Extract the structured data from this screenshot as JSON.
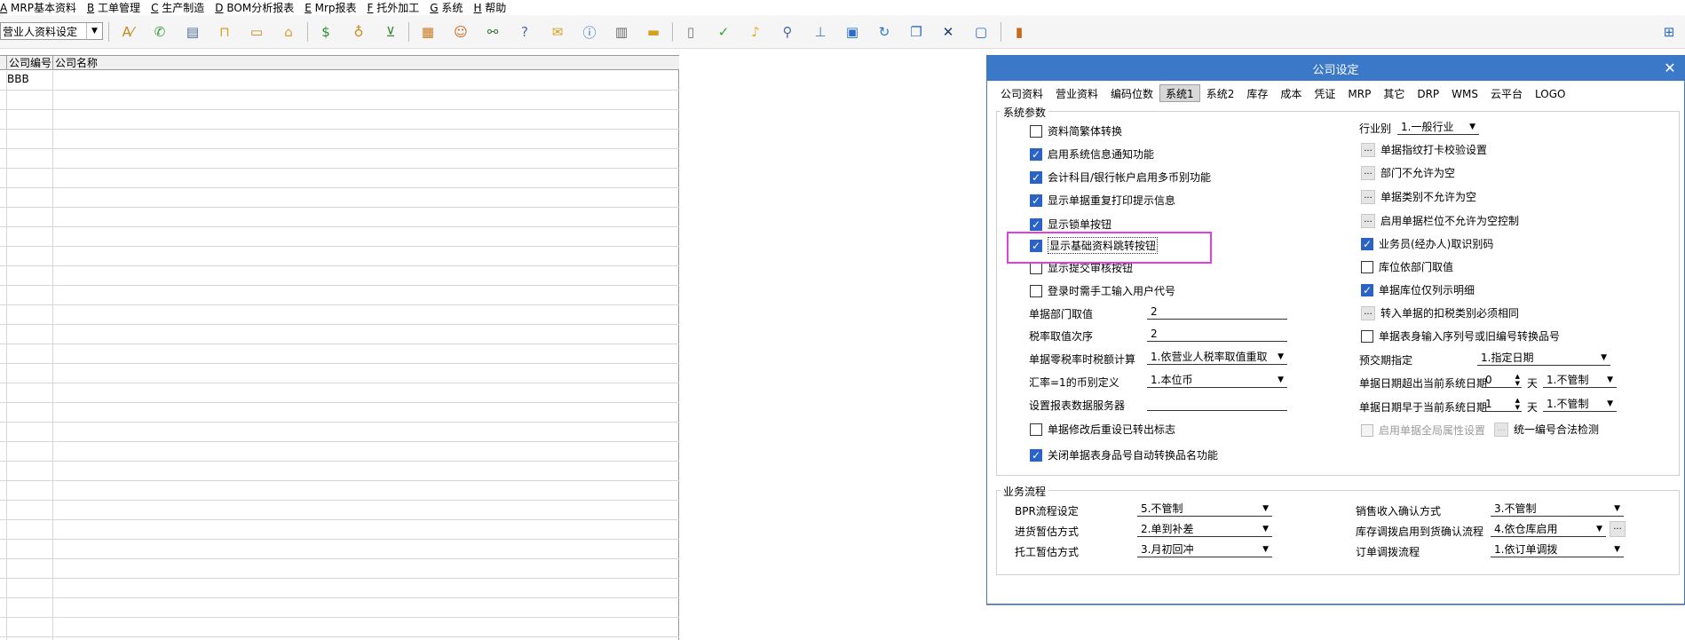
{
  "menu": [
    {
      "key": "A",
      "label": "MRP基本资料"
    },
    {
      "key": "B",
      "label": "工单管理"
    },
    {
      "key": "C",
      "label": "生产制造"
    },
    {
      "key": "D",
      "label": "BOM分析报表"
    },
    {
      "key": "E",
      "label": "Mrp报表"
    },
    {
      "key": "F",
      "label": "托外加工"
    },
    {
      "key": "G",
      "label": "系统"
    },
    {
      "key": "H",
      "label": "帮助"
    }
  ],
  "toolbar": {
    "company_select": "营业人资料设定"
  },
  "grid": {
    "headers": [
      "公司编号",
      "公司名称"
    ],
    "rows": [
      [
        "BBB",
        ""
      ]
    ]
  },
  "dialog": {
    "title": "公司设定",
    "close": "✕",
    "tabs": [
      "公司资料",
      "营业资料",
      "编码位数",
      "系统1",
      "系统2",
      "库存",
      "成本",
      "凭证",
      "MRP",
      "其它",
      "DRP",
      "WMS",
      "云平台",
      "LOGO"
    ],
    "active_tab": "系统1",
    "sys_params": {
      "title": "系统参数",
      "left_checks": [
        {
          "label": "资料简繁体转换",
          "checked": false
        },
        {
          "label": "启用系统信息通知功能",
          "checked": true
        },
        {
          "label": "会计科目/银行帐户启用多币别功能",
          "checked": true
        },
        {
          "label": "显示单据重复打印提示信息",
          "checked": true
        },
        {
          "label": "显示锁单按钮",
          "checked": true
        },
        {
          "label": "显示基础资料跳转按钮",
          "checked": true
        },
        {
          "label": "显示提交审核按钮",
          "checked": false
        },
        {
          "label": "登录时需手工输入用户代号",
          "checked": false
        }
      ],
      "fields": [
        {
          "label": "单据部门取值",
          "value": "2"
        },
        {
          "label": "税率取值次序",
          "value": "2"
        },
        {
          "label": "单据零税率时税额计算",
          "value": "1.依营业人税率取值重取"
        },
        {
          "label": "汇率=1的币别定义",
          "value": "1.本位币"
        },
        {
          "label": "设置报表数据服务器",
          "value": ""
        }
      ],
      "left_checks_bottom": [
        {
          "label": "单据修改后重设已转出标志",
          "checked": false
        },
        {
          "label": "关闭单据表身品号自动转换品名功能",
          "checked": true
        }
      ],
      "industry_label": "行业别",
      "industry_value": "1.一般行业",
      "right_items": [
        {
          "label": "单据指纹打卡校验设置",
          "type": "btn"
        },
        {
          "label": "部门不允许为空",
          "type": "btn"
        },
        {
          "label": "单据类别不允许为空",
          "type": "btn"
        },
        {
          "label": "启用单据栏位不允许为空控制",
          "type": "btn"
        },
        {
          "label": "业务员(经办人)取识别码",
          "type": "cb",
          "checked": true
        },
        {
          "label": "库位依部门取值",
          "type": "cb",
          "checked": false
        },
        {
          "label": "单据库位仅列示明细",
          "type": "cb",
          "checked": true
        },
        {
          "label": "转入单据的扣税类别必须相同",
          "type": "btn"
        },
        {
          "label": "单据表身输入序列号或旧编号转换品号",
          "type": "cb",
          "checked": false
        }
      ],
      "pre_delivery": {
        "label": "预交期指定",
        "value": "1.指定日期"
      },
      "date_over": {
        "label": "单据日期超出当前系统日期",
        "num": "0",
        "unit": "天",
        "value": "1.不管制"
      },
      "date_early": {
        "label": "单据日期早于当前系统日期",
        "num": "1",
        "unit": "天",
        "value": "1.不管制"
      },
      "global_attr": {
        "label": "启用单据全局属性设置",
        "checked": false
      },
      "unified_check": "统一编号合法检测"
    },
    "workflow": {
      "title": "业务流程",
      "left": [
        {
          "label": "BPR流程设定",
          "value": "5.不管制"
        },
        {
          "label": "进货暂估方式",
          "value": "2.单到补差"
        },
        {
          "label": "托工暂估方式",
          "value": "3.月初回冲"
        }
      ],
      "right": [
        {
          "label": "销售收入确认方式",
          "value": "3.不管制"
        },
        {
          "label": "库存调拨启用到货确认流程",
          "value": "4.依仓库启用"
        },
        {
          "label": "订单调拨流程",
          "value": "1.依订单调拨"
        }
      ]
    }
  },
  "colors": {
    "title_bar": "#3c78c8",
    "check": "#2a62c6",
    "highlight": "#e040e0"
  }
}
